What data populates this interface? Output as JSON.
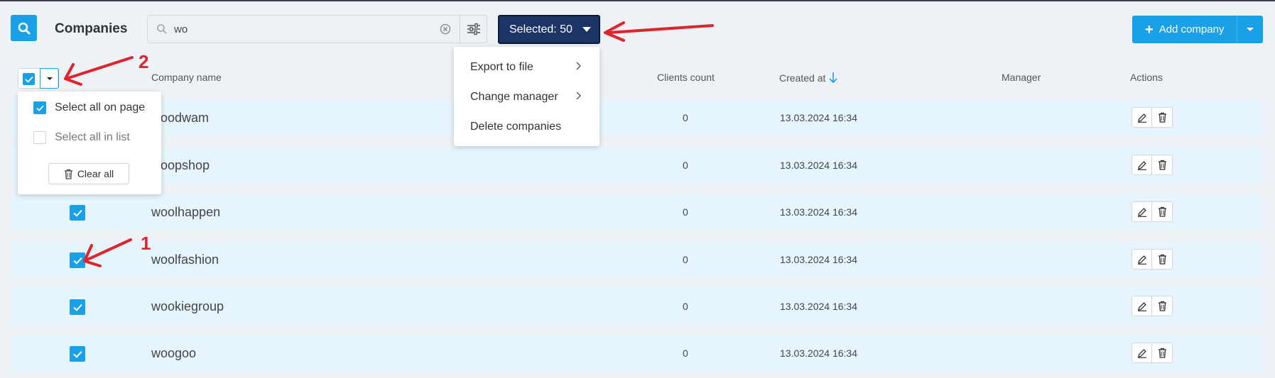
{
  "header": {
    "title": "Companies",
    "search_value": "wo",
    "selected_label": "Selected: 50",
    "add_label": "Add company"
  },
  "table": {
    "columns": {
      "company_name": "Company name",
      "clients_count": "Clients count",
      "created_at": "Created at",
      "manager": "Manager",
      "actions": "Actions"
    },
    "rows": [
      {
        "name": "woodwam",
        "count": "0",
        "date": "13.03.2024 16:34",
        "checked": true
      },
      {
        "name": "woopshop",
        "count": "0",
        "date": "13.03.2024 16:34",
        "checked": true
      },
      {
        "name": "woolhappen",
        "count": "0",
        "date": "13.03.2024 16:34",
        "checked": true
      },
      {
        "name": "woolfashion",
        "count": "0",
        "date": "13.03.2024 16:34",
        "checked": true
      },
      {
        "name": "wookiegroup",
        "count": "0",
        "date": "13.03.2024 16:34",
        "checked": true
      },
      {
        "name": "woogoo",
        "count": "0",
        "date": "13.03.2024 16:34",
        "checked": true
      }
    ]
  },
  "select_menu": {
    "select_page": "Select all on page",
    "select_list": "Select all in list",
    "clear": "Clear all"
  },
  "action_menu": {
    "export": "Export to file",
    "change_manager": "Change manager",
    "delete": "Delete companies"
  },
  "annotations": {
    "one": "1",
    "two": "2"
  },
  "colors": {
    "accent": "#1aa0e6",
    "selected_button": "#1c3466",
    "row_bg": "#e6f5fd",
    "annotation_red": "#e0242e"
  }
}
